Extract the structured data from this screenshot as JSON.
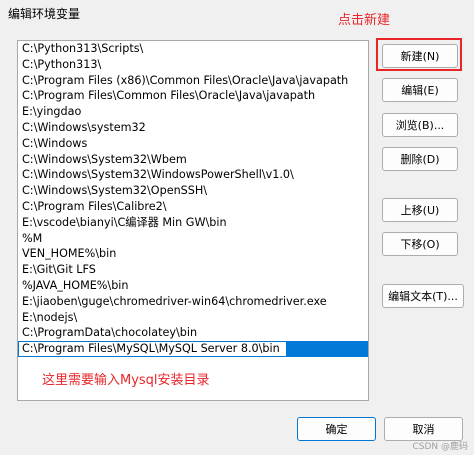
{
  "window": {
    "title": "编辑环境变量"
  },
  "annotations": {
    "new_hint": "点击新建",
    "edit_hint": "这里需要输入Mysql安装目录"
  },
  "path_list": [
    "C:\\Python313\\Scripts\\",
    "C:\\Python313\\",
    "C:\\Program Files (x86)\\Common Files\\Oracle\\Java\\javapath",
    "C:\\Program Files\\Common Files\\Oracle\\Java\\javapath",
    "E:\\yingdao",
    "C:\\Windows\\system32",
    "C:\\Windows",
    "C:\\Windows\\System32\\Wbem",
    "C:\\Windows\\System32\\WindowsPowerShell\\v1.0\\",
    "C:\\Windows\\System32\\OpenSSH\\",
    "C:\\Program Files\\Calibre2\\",
    "E:\\vscode\\bianyi\\C编译器 Min GW\\bin",
    "%M",
    "VEN_HOME%\\bin",
    "E:\\Git\\Git LFS",
    "%JAVA_HOME%\\bin",
    "E:\\jiaoben\\guge\\chromedriver-win64\\chromedriver.exe",
    "E:\\nodejs\\",
    "C:\\ProgramData\\chocolatey\\bin"
  ],
  "editing_entry": "C:\\Program Files\\MySQL\\MySQL Server 8.0\\bin",
  "buttons": {
    "new": "新建(N)",
    "edit": "编辑(E)",
    "browse": "浏览(B)...",
    "delete": "删除(D)",
    "move_up": "上移(U)",
    "move_down": "下移(O)",
    "edit_text": "编辑文本(T)...",
    "ok": "确定",
    "cancel": "取消"
  },
  "watermark": "CSDN @鹿码"
}
